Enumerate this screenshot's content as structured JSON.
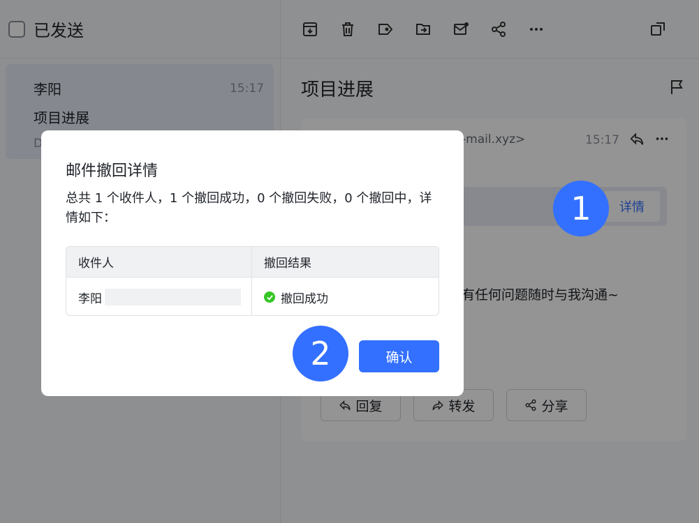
{
  "sidebar": {
    "folder_title": "已发送"
  },
  "mail_list": {
    "items": [
      {
        "sender": "李阳",
        "time": "15:17",
        "subject": "项目进展",
        "preview": "D"
      }
    ]
  },
  "reader": {
    "subject": "项目进展",
    "address_fragment": "-mail.xyz>",
    "time": "15:17",
    "detail_label": "详情",
    "body_fragment": "有任何问题随时与我沟通~",
    "actions": {
      "reply": "回复",
      "forward": "转发",
      "share": "分享"
    }
  },
  "dialog": {
    "title": "邮件撤回详情",
    "description": "总共 1 个收件人，1 个撤回成功，0 个撤回失败，0 个撤回中，详情如下：",
    "table": {
      "headers": [
        "收件人",
        "撤回结果"
      ],
      "rows": [
        {
          "recipient": "李阳",
          "result": "撤回成功"
        }
      ]
    },
    "confirm_label": "确认"
  },
  "badges": {
    "step1": "1",
    "step2": "2"
  },
  "colors": {
    "accent": "#3370ff",
    "success": "#34c724"
  }
}
